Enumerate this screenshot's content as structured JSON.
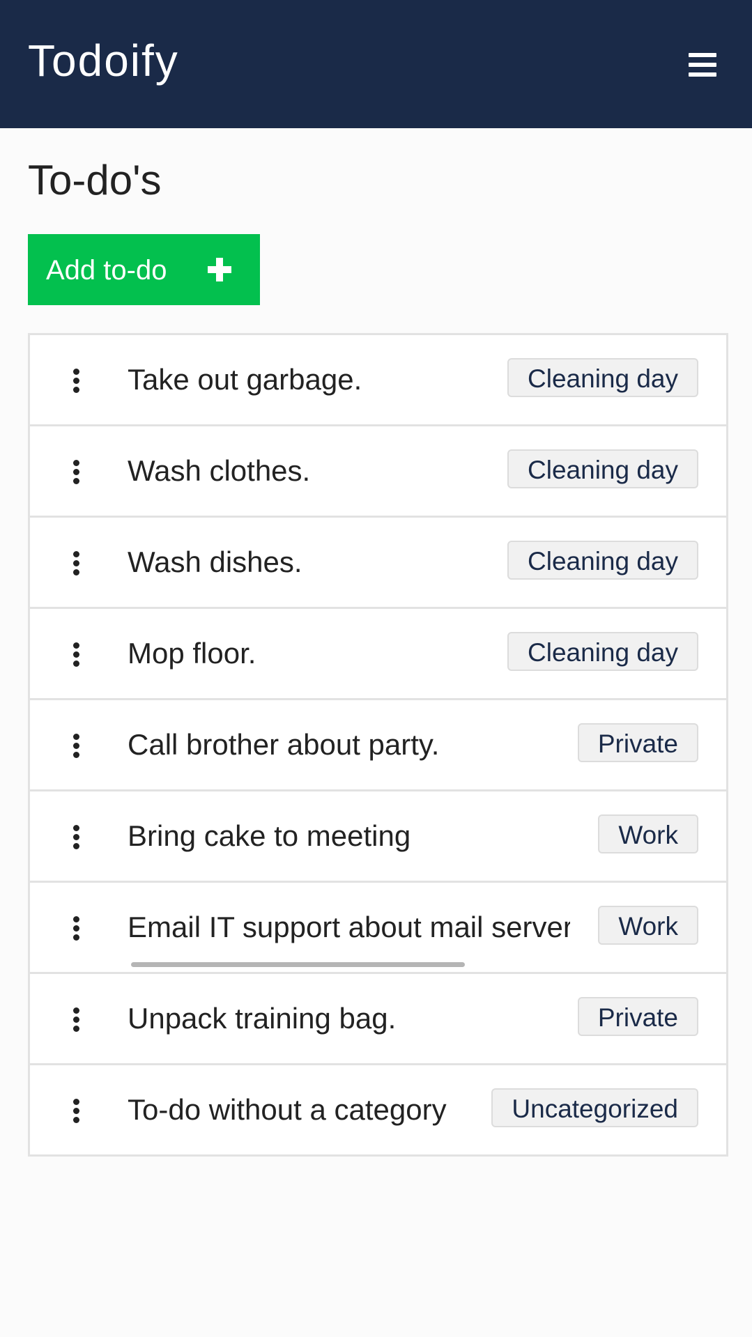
{
  "header": {
    "app_title": "Todoify",
    "menu_icon": "hamburger-menu-icon",
    "background_color": "#1a2a48"
  },
  "main": {
    "page_title": "To-do's",
    "add_button": {
      "label": "Add to-do",
      "icon": "plus-icon",
      "color": "#03c04e"
    },
    "todos": [
      {
        "text": "Take out garbage.",
        "category": "Cleaning day"
      },
      {
        "text": "Wash clothes.",
        "category": "Cleaning day"
      },
      {
        "text": "Wash dishes.",
        "category": "Cleaning day"
      },
      {
        "text": "Mop floor.",
        "category": "Cleaning day"
      },
      {
        "text": "Call brother about party.",
        "category": "Private"
      },
      {
        "text": "Bring cake to meeting",
        "category": "Work"
      },
      {
        "text": "Email IT support about mail server",
        "category": "Work"
      },
      {
        "text": "Unpack training bag.",
        "category": "Private"
      },
      {
        "text": "To-do without a category",
        "category": "Uncategorized"
      }
    ]
  }
}
